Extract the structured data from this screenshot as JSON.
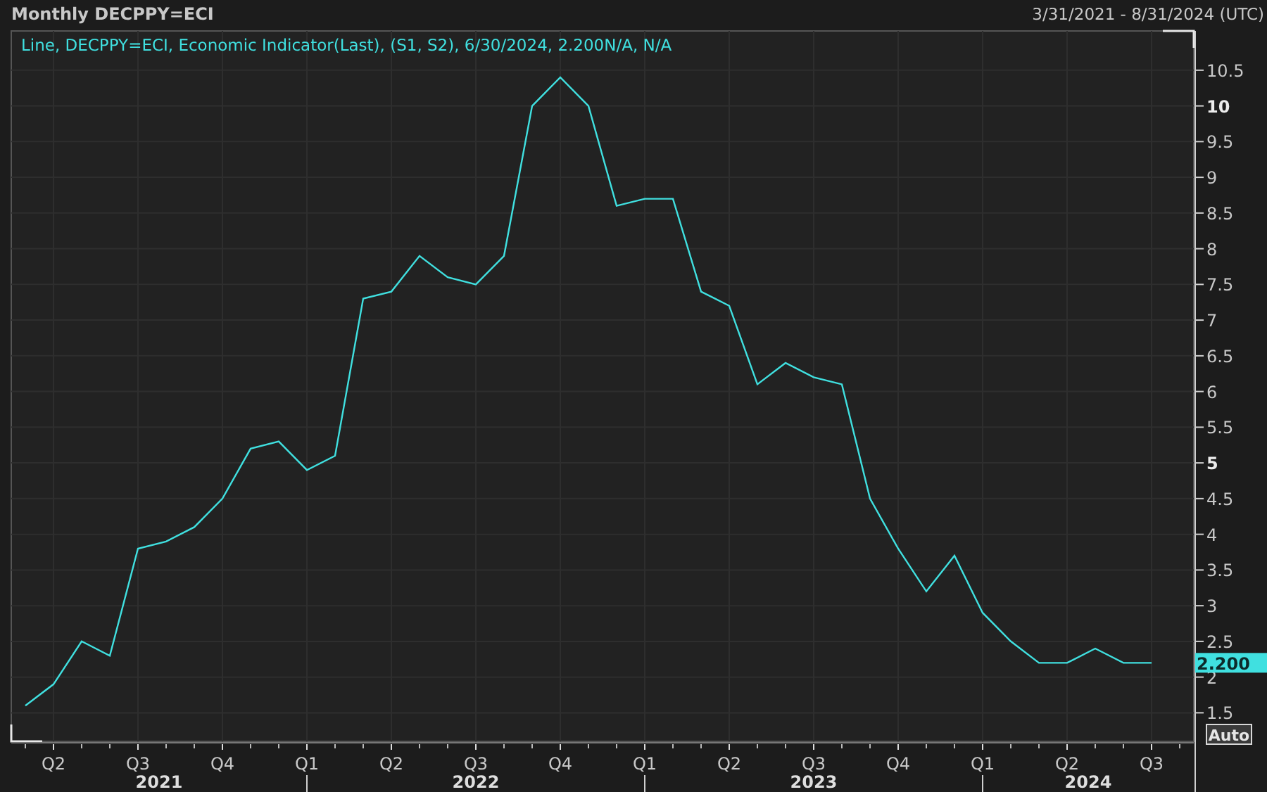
{
  "header": {
    "title": "Monthly DECPPY=ECI",
    "range": "3/31/2021 - 8/31/2024 (UTC)"
  },
  "chart": {
    "legend": "Line, DECPPY=ECI, Economic Indicator(Last), (S1, S2), 6/30/2024, 2.200N/A, N/A",
    "last_value": "2.200",
    "auto_button": "Auto",
    "year_labels": [
      "2021",
      "2022",
      "2023",
      "2024"
    ],
    "chart_data": {
      "type": "line",
      "grid": true,
      "categories": [
        null,
        "Q2",
        null,
        null,
        "Q3",
        null,
        null,
        "Q4",
        null,
        null,
        "Q1",
        null,
        null,
        "Q2",
        null,
        null,
        "Q3",
        null,
        null,
        "Q4",
        null,
        null,
        "Q1",
        null,
        null,
        "Q2",
        null,
        null,
        "Q3",
        null,
        null,
        "Q4",
        null,
        null,
        "Q1",
        null,
        null,
        "Q2",
        null,
        null,
        "Q3"
      ],
      "series": [
        {
          "color": "#40e0e0",
          "values": [
            1.6,
            1.9,
            2.5,
            2.3,
            3.8,
            3.9,
            4.1,
            4.5,
            5.2,
            5.3,
            4.9,
            5.1,
            7.3,
            7.4,
            7.9,
            7.6,
            7.5,
            7.9,
            10.0,
            10.4,
            10.0,
            8.6,
            8.7,
            8.7,
            7.4,
            7.2,
            6.1,
            6.4,
            6.2,
            6.1,
            4.5,
            3.8,
            3.2,
            3.7,
            2.9,
            2.5,
            2.2,
            2.2,
            2.4,
            2.2,
            2.2
          ]
        }
      ],
      "ylim": [
        1.1,
        11.05
      ],
      "yticks": [
        1.5,
        2,
        2.5,
        3,
        3.5,
        4,
        4.5,
        5,
        5.5,
        6,
        6.5,
        7,
        7.5,
        8,
        8.5,
        9,
        9.5,
        10,
        10.5
      ]
    }
  }
}
